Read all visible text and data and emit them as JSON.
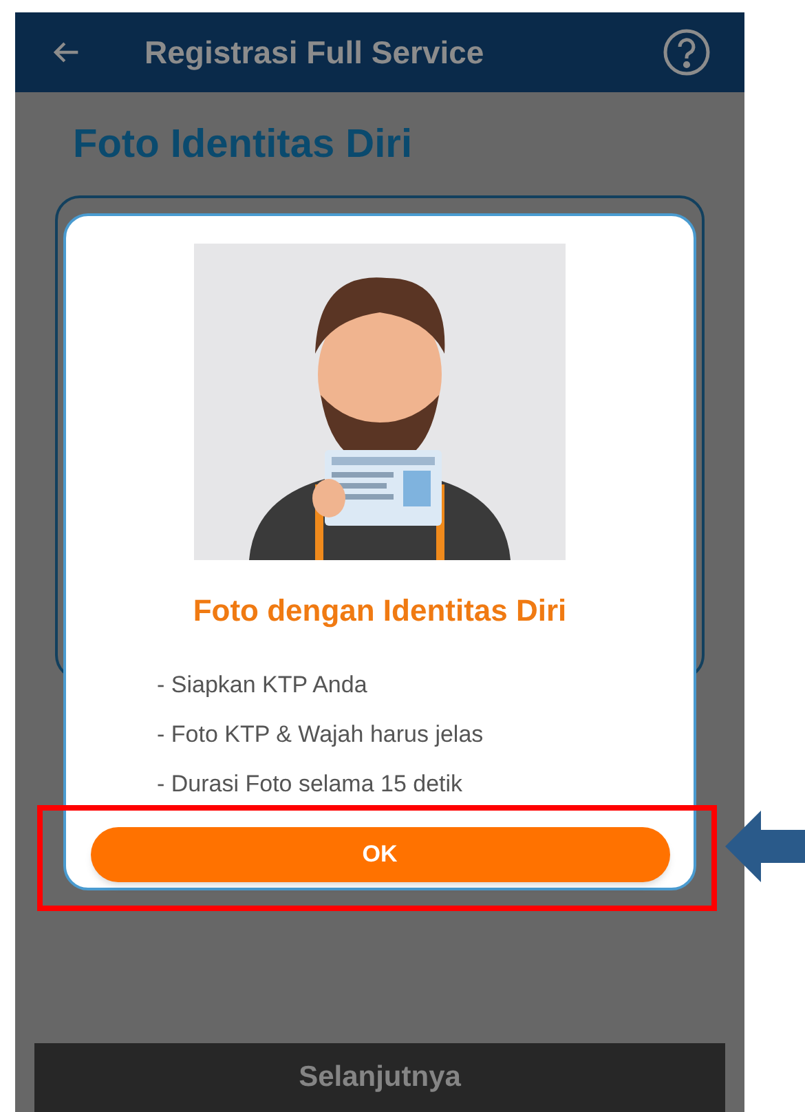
{
  "app_bar": {
    "title": "Registrasi Full Service"
  },
  "page": {
    "heading": "Foto Identitas Diri",
    "next_button": {
      "label": "Selanjutnya"
    }
  },
  "dialog": {
    "title": "Foto dengan Identitas Diri",
    "items": [
      "- Siapkan KTP Anda",
      "- Foto KTP & Wajah harus jelas",
      "- Durasi Foto selama 15 detik"
    ],
    "button": {
      "label": "OK"
    }
  }
}
